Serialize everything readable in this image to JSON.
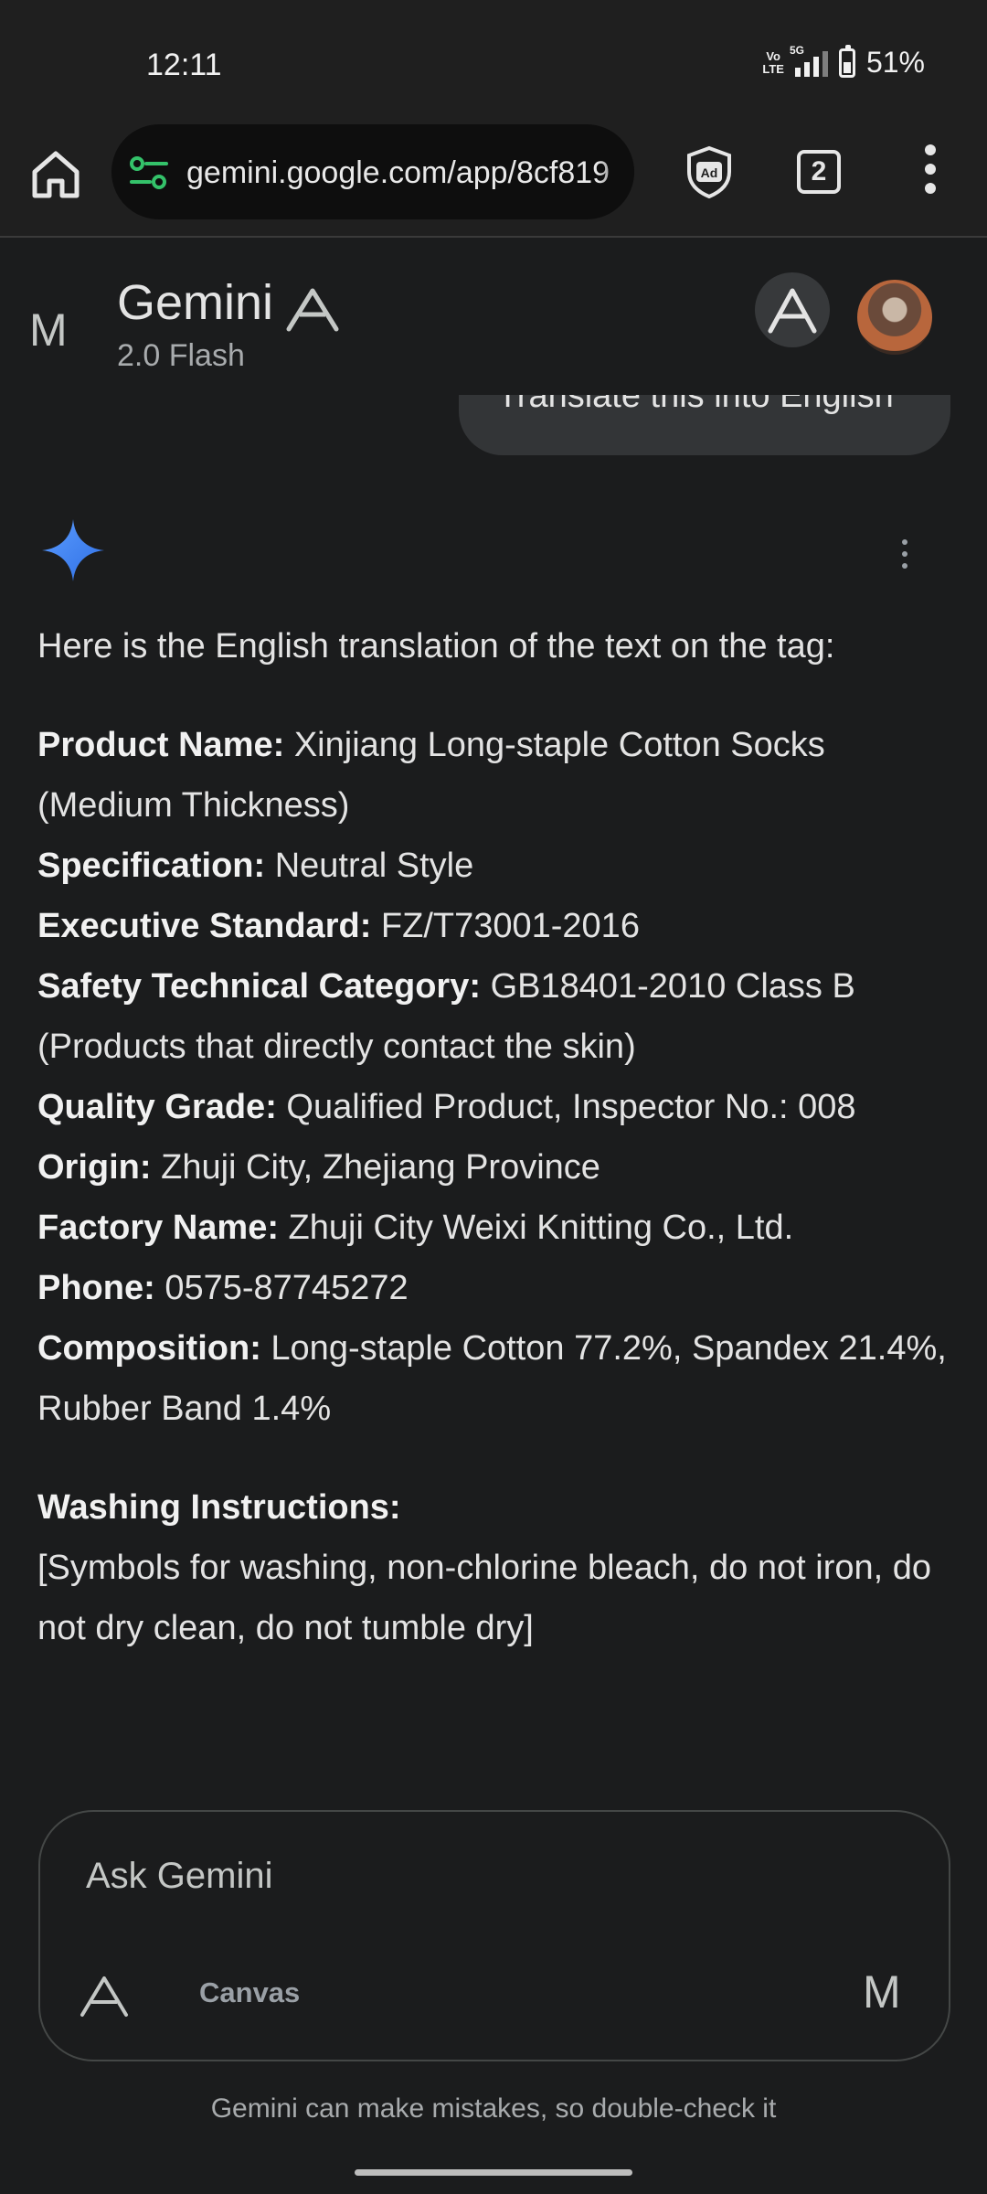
{
  "status_bar": {
    "time": "12:11",
    "volte_top": "Vo",
    "volte_bottom": "LTE",
    "network": "5G",
    "battery": "51%"
  },
  "browser": {
    "url": "gemini.google.com/app/8cf819",
    "tab_count": "2"
  },
  "header": {
    "menu_glyph": "M",
    "title": "Gemini",
    "model": "2.0 Flash"
  },
  "user_message": "Translate this into English",
  "response": {
    "intro": "Here is the English translation of the text on the tag:",
    "fields": [
      {
        "label": "Product Name:",
        "value": " Xinjiang Long-staple Cotton Socks (Medium Thickness)"
      },
      {
        "label": "Specification:",
        "value": " Neutral Style"
      },
      {
        "label": "Executive Standard:",
        "value": " FZ/T73001-2016"
      },
      {
        "label": "Safety Technical Category:",
        "value": " GB18401-2010 Class B (Products that directly contact the skin)"
      },
      {
        "label": "Quality Grade:",
        "value": " Qualified Product, Inspector No.: 008"
      },
      {
        "label": "Origin:",
        "value": " Zhuji City, Zhejiang Province"
      },
      {
        "label": "Factory Name:",
        "value": " Zhuji City Weixi Knitting Co., Ltd."
      },
      {
        "label": "Phone:",
        "value": " 0575-87745272"
      },
      {
        "label": "Composition:",
        "value": " Long-staple Cotton 77.2%, Spandex 21.4%, Rubber Band 1.4%"
      }
    ],
    "washing_heading": "Washing Instructions:",
    "washing_text": "[Symbols for washing, non-chlorine bleach, do not iron, do not dry clean, do not tumble dry]"
  },
  "input": {
    "placeholder": "Ask Gemini",
    "canvas_label": "Canvas",
    "mic_glyph": "M"
  },
  "disclaimer": "Gemini can make mistakes, so double-check it",
  "colors": {
    "background": "#1b1c1d",
    "chrome": "#1f1f1f",
    "text": "#e3e3e3",
    "muted": "#a8abad",
    "spark_blue": "#4c8df6"
  },
  "icons": [
    "home-icon",
    "tune-icon",
    "adblock-shield-icon",
    "tabs-icon",
    "more-vert-icon",
    "chevron-icon",
    "new-chat-icon",
    "gemini-spark-icon",
    "tools-icon",
    "mic-icon"
  ]
}
